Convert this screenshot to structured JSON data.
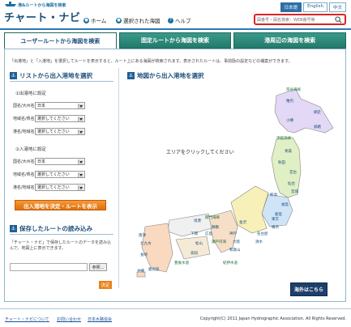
{
  "header": {
    "subtitle": "港&ルートから海図を検索",
    "title": "チャート・ナビ",
    "nav": [
      {
        "label": "ホーム"
      },
      {
        "label": "選択された海図"
      },
      {
        "label": "ヘルプ"
      }
    ],
    "languages": [
      "日本語",
      "English",
      "中文"
    ],
    "search_placeholder": "図番号・図名検索：WEB番号等"
  },
  "tabs": [
    "ユーザールートから海図を検索",
    "固定ルートから海図を検索",
    "港周辺の海図を検索"
  ],
  "intro": "「出港地」と「入港地」を選択してルートを表示すると、ルート上にある海図が検索されます。表示されたルートは、事前励の設定などの補案ができます。",
  "list_section": {
    "heading": "リストから出入港地を選択",
    "departure": {
      "heading": "①出港地に設定",
      "fields": [
        {
          "label": "国名/大州名",
          "value": "日本"
        },
        {
          "label": "地域名/県名",
          "value": "選択してください"
        },
        {
          "label": "港名/地域名",
          "value": "選択してください"
        }
      ]
    },
    "arrival": {
      "heading": "②入港地に設定",
      "fields": [
        {
          "label": "国名/大州名",
          "value": "日本"
        },
        {
          "label": "地域名/県名",
          "value": "選択してください"
        },
        {
          "label": "港名/地域名",
          "value": "選択してください"
        }
      ]
    },
    "submit": "出入港地を決定・ルートを表示"
  },
  "load_section": {
    "heading": "保存したルートの読み込み",
    "text": "「チャート・ナビ」で保存したルートのデータを読み込んで、地図上に表示できます。",
    "browse": "参照...",
    "ok": "決定"
  },
  "map_section": {
    "heading": "地図から出入港地を選択",
    "hint": "エリアをクリックしてください",
    "overseas": "海外はこちら",
    "regions": [
      "宗谷海峡",
      "稚内",
      "網走",
      "小樽",
      "釧路",
      "津軽海峡",
      "青森",
      "秋田",
      "宮古",
      "仙台",
      "宮城",
      "新潟",
      "福島",
      "関門海峡",
      "境港",
      "舞鶴",
      "金沢",
      "鹿島",
      "下関",
      "広島",
      "神戸",
      "名古屋",
      "清水",
      "東京",
      "横浜",
      "唐津",
      "北九州",
      "松山",
      "高知",
      "瀬戸内海",
      "大阪",
      "和歌山",
      "紀伊水道",
      "長崎",
      "鹿児島",
      "豊後水道",
      "沖縄"
    ]
  },
  "footer": {
    "links": [
      "チャート・ナビについて",
      "お問い合わせ",
      "日本水路協会"
    ],
    "copyright": "Copyright(C) 2011 Japan Hydrographic Association. All Rights Reserved."
  },
  "colors": {
    "accent": "#2f7ab5",
    "tab": "#237a6c",
    "orange": "#e06f0a",
    "navy": "#1e3f6a",
    "map_hokkaido": "#e3d8f5",
    "map_tohoku": "#e0efc4",
    "map_kanto": "#cfe5f7",
    "map_chubu": "#f7f0b8",
    "map_kinki": "#f6dfc6",
    "map_chugoku": "#f0f0f0",
    "map_kyushu": "#f9d9c0"
  }
}
